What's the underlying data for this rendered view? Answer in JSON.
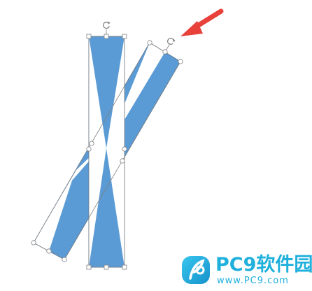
{
  "colors": {
    "shape_fill": "#5b9bd5",
    "shape_stroke": "#4a86c0",
    "selection_line": "#7f7f7f",
    "handle_fill": "#ffffff",
    "arrow": "#e8413a",
    "watermark": "#1fb0dc"
  },
  "shapes": [
    {
      "name": "vertical-hourglass",
      "selected": true,
      "rotation_handle_icon": "rotate-icon"
    },
    {
      "name": "tilted-hourglass",
      "selected": true,
      "rotation_handle_icon": "rotate-icon"
    }
  ],
  "annotation": {
    "icon": "red-arrow-icon",
    "points_to": "rotation-handle-tilted"
  },
  "watermark": {
    "title": "PC9软件园",
    "url": "www.PC9.com"
  }
}
